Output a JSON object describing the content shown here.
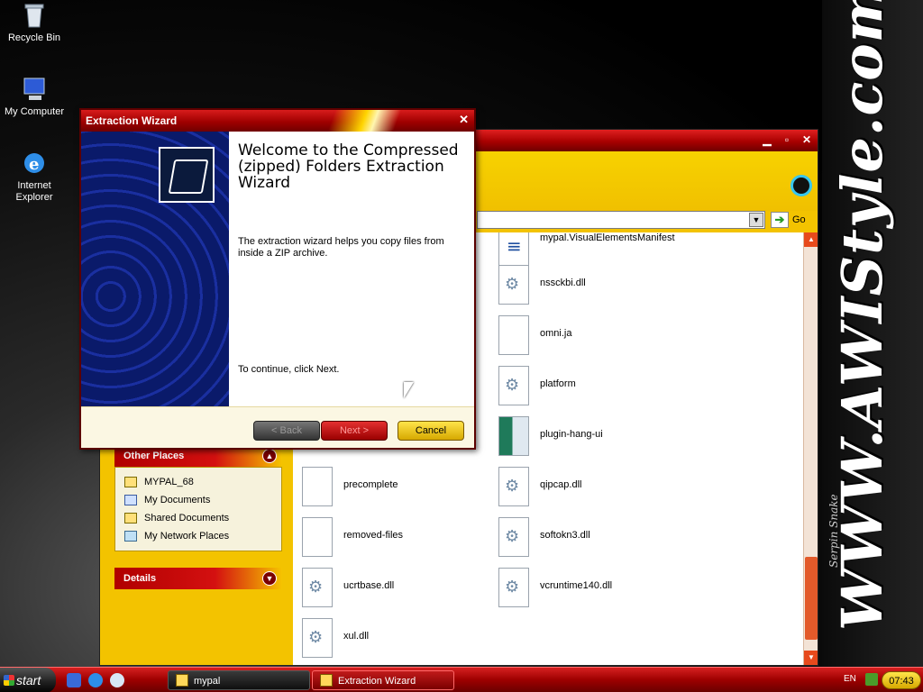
{
  "desktop": {
    "icons": [
      {
        "label": "Recycle Bin"
      },
      {
        "label": "My Computer"
      },
      {
        "label": "Internet Explorer"
      }
    ],
    "brand_text": "WWW.AWIStyle.com",
    "brand_sub": "Serpin Snake"
  },
  "explorer": {
    "address_go": "Go",
    "other_places": {
      "title": "Other Places",
      "items": [
        "MYPAL_68",
        "My Documents",
        "Shared Documents",
        "My Network Places"
      ]
    },
    "details_title": "Details",
    "files": [
      {
        "name": "mypal.VisualElementsManifest",
        "kind": "xml"
      },
      {
        "name": "nssckbi.dll",
        "kind": "dll"
      },
      {
        "name": "omni.ja",
        "kind": "file"
      },
      {
        "name": "platform",
        "kind": "dll"
      },
      {
        "name": "plugin-hang-ui",
        "kind": "exe"
      },
      {
        "name": "precomplete",
        "kind": "file"
      },
      {
        "name": "qipcap.dll",
        "kind": "dll"
      },
      {
        "name": "removed-files",
        "kind": "file"
      },
      {
        "name": "softokn3.dll",
        "kind": "dll"
      },
      {
        "name": "ucrtbase.dll",
        "kind": "dll"
      },
      {
        "name": "vcruntime140.dll",
        "kind": "dll"
      },
      {
        "name": "xul.dll",
        "kind": "dll"
      }
    ]
  },
  "wizard": {
    "title": "Extraction Wizard",
    "heading": "Welcome to the Compressed (zipped) Folders Extraction Wizard",
    "description": "The extraction wizard helps you copy files from inside a ZIP archive.",
    "continue_text": "To continue, click Next.",
    "buttons": {
      "back": "< Back",
      "next": "Next >",
      "cancel": "Cancel"
    }
  },
  "taskbar": {
    "start": "start",
    "tasks": [
      "mypal",
      "Extraction Wizard"
    ],
    "language": "EN",
    "clock": "07:43"
  }
}
